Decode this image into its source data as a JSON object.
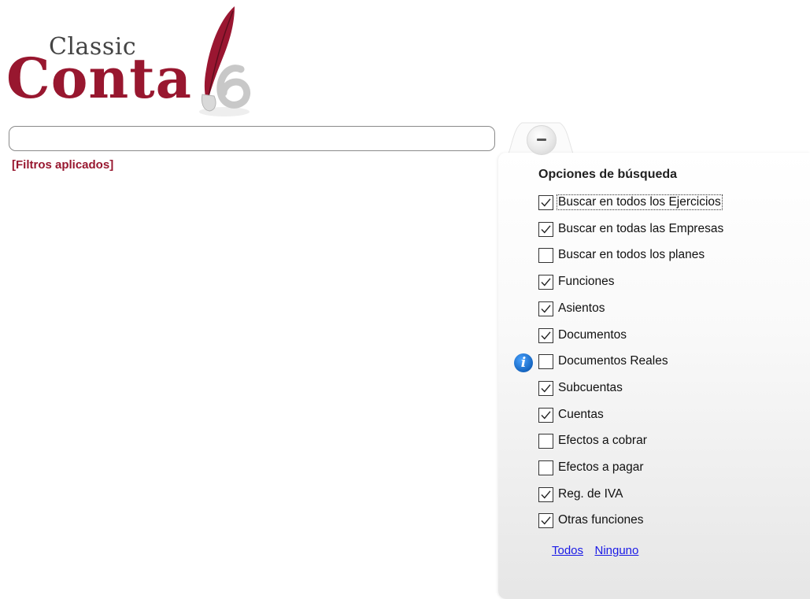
{
  "logo": {
    "top_word": "Classic",
    "main_word": "Conta",
    "version": "6"
  },
  "search": {
    "value": "",
    "placeholder": ""
  },
  "filters_label": "[Filtros aplicados]",
  "panel": {
    "title": "Opciones de búsqueda",
    "options": [
      {
        "label": "Buscar en todos los Ejercicios",
        "checked": true
      },
      {
        "label": "Buscar en todas las Empresas",
        "checked": true
      },
      {
        "label": "Buscar en todos los planes",
        "checked": false
      },
      {
        "label": "Funciones",
        "checked": true
      },
      {
        "label": "Asientos",
        "checked": true
      },
      {
        "label": "Documentos",
        "checked": true
      },
      {
        "label": "Documentos Reales",
        "checked": false
      },
      {
        "label": "Subcuentas",
        "checked": true
      },
      {
        "label": "Cuentas",
        "checked": true
      },
      {
        "label": "Efectos a cobrar",
        "checked": false
      },
      {
        "label": "Efectos a pagar",
        "checked": false
      },
      {
        "label": "Reg. de IVA",
        "checked": true
      },
      {
        "label": "Otras funciones",
        "checked": true
      }
    ],
    "links": {
      "all": "Todos",
      "none": "Ninguno"
    }
  },
  "colors": {
    "brand": "#98172f",
    "link": "#1a1ae6",
    "info": "#1565c0"
  },
  "icons": {
    "collapse": "minus-circle-icon",
    "info": "info-icon",
    "logo": "quill-pen-icon"
  }
}
